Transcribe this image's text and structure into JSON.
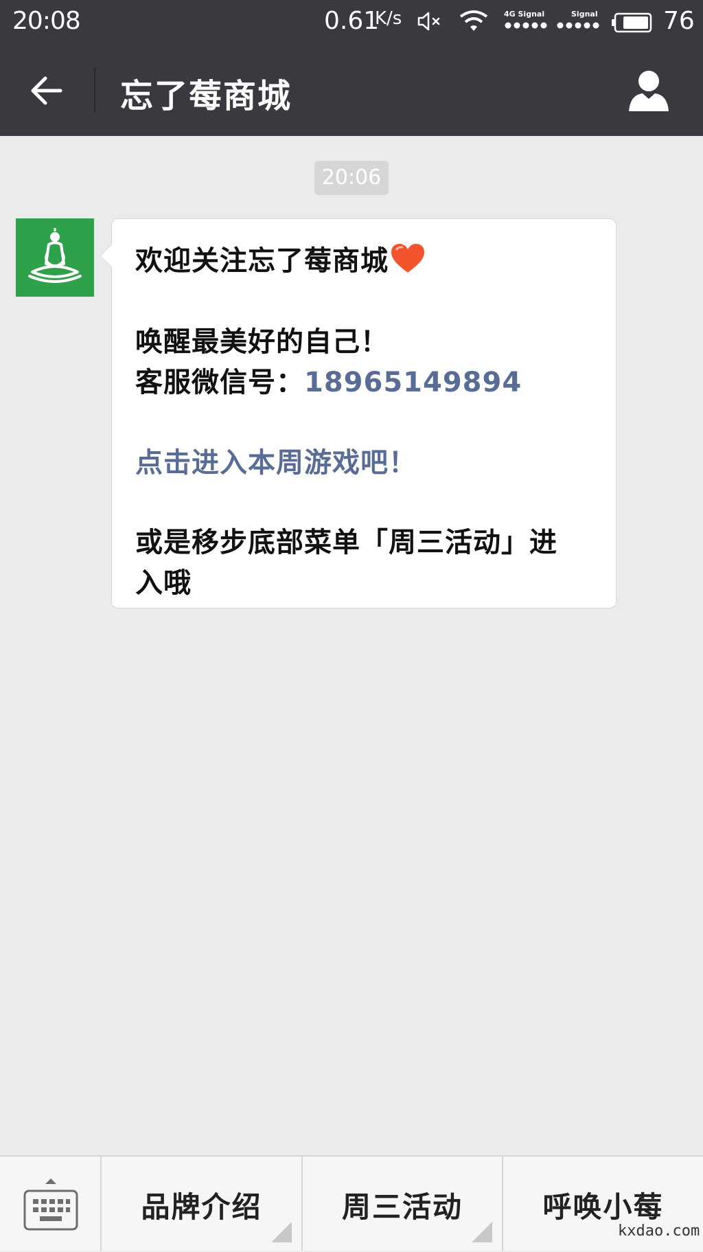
{
  "status_bar": {
    "time": "20:08",
    "speed": "0.61",
    "speed_unit": "K/s",
    "signal1_label": "4G Signal",
    "signal2_label": "Signal",
    "battery": "76"
  },
  "header": {
    "title": "忘了莓商城",
    "back_icon": "arrow-left-icon",
    "profile_icon": "user-icon"
  },
  "chat": {
    "timestamp": "20:06",
    "avatar_icon": "meditation-figure-icon",
    "message": {
      "line1": "欢迎关注忘了莓商城",
      "line2": "唤醒最美好的自己！",
      "line3_prefix": "客服微信号：",
      "phone": "18965149894",
      "link_text": "点击进入本周游戏吧！",
      "line5": "或是移步底部菜单「周三活动」进",
      "line6": "入哦"
    }
  },
  "menu": {
    "keyboard_icon": "keyboard-icon",
    "items": [
      {
        "label": "品牌介绍"
      },
      {
        "label": "周三活动"
      },
      {
        "label": "呼唤小莓"
      }
    ]
  },
  "watermark": "kxdao.com",
  "colors": {
    "header_bg": "#393a3f",
    "chat_bg": "#ebebeb",
    "link": "#586c96",
    "avatar_bg": "#2fa14b",
    "heart": "#f2542d"
  }
}
